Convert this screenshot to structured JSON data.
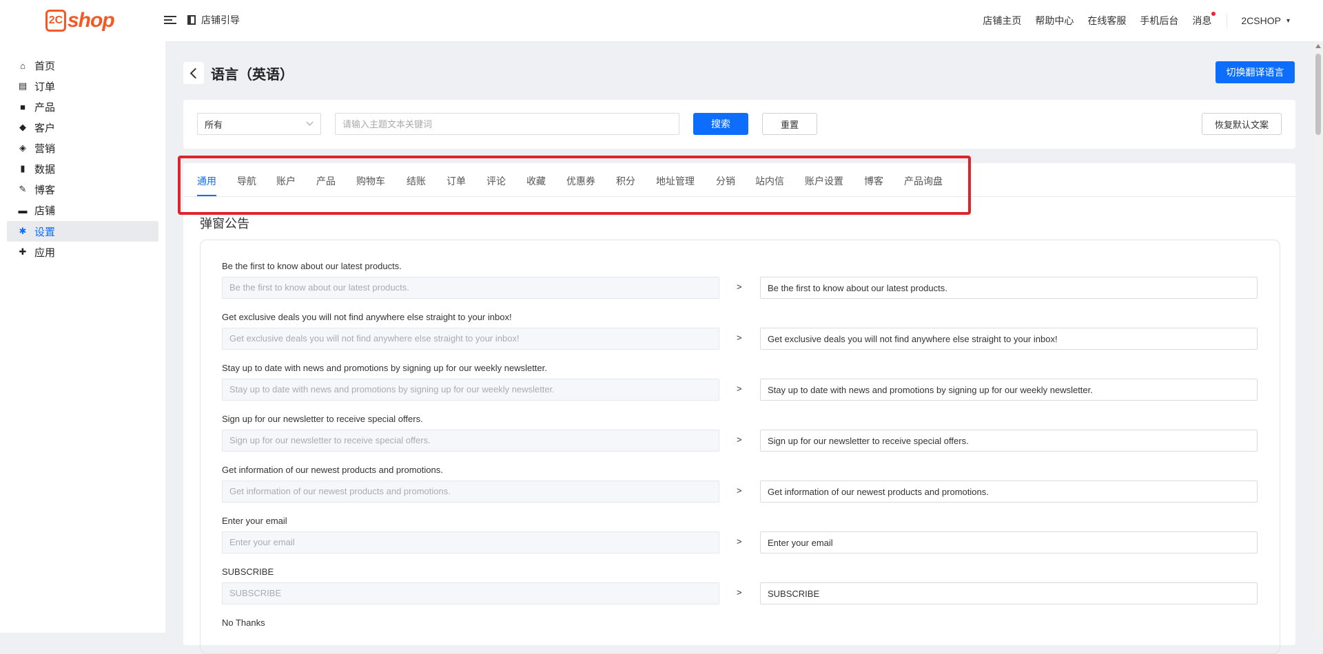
{
  "brand": {
    "logo_mark": "2C",
    "logo_text": "shop"
  },
  "header": {
    "guide_label": "店铺引导",
    "links": [
      "店铺主页",
      "帮助中心",
      "在线客服",
      "手机后台",
      "消息"
    ],
    "user": "2CSHOP"
  },
  "sidebar": {
    "items": [
      {
        "label": "首页",
        "icon": "home-icon"
      },
      {
        "label": "订单",
        "icon": "clipboard-icon"
      },
      {
        "label": "产品",
        "icon": "bag-icon"
      },
      {
        "label": "客户",
        "icon": "diamond-icon"
      },
      {
        "label": "营销",
        "icon": "tag-icon"
      },
      {
        "label": "数据",
        "icon": "bar-chart-icon"
      },
      {
        "label": "博客",
        "icon": "edit-icon"
      },
      {
        "label": "店铺",
        "icon": "store-icon"
      },
      {
        "label": "设置",
        "icon": "gear-icon"
      },
      {
        "label": "应用",
        "icon": "puzzle-icon"
      }
    ],
    "active_index": 8
  },
  "page": {
    "title": "语言（英语）",
    "switch_button": "切换翻译语言"
  },
  "filter": {
    "select_value": "所有",
    "search_placeholder": "请输入主题文本关键词",
    "search_button": "搜索",
    "reset_button": "重置",
    "restore_button": "恢复默认文案"
  },
  "tabs": [
    "通用",
    "导航",
    "账户",
    "产品",
    "购物车",
    "结账",
    "订单",
    "评论",
    "收藏",
    "优惠券",
    "积分",
    "地址管理",
    "分销",
    "站内信",
    "账户设置",
    "博客",
    "产品询盘"
  ],
  "active_tab": 0,
  "section_title": "弹窗公告",
  "fields": [
    {
      "label": "Be the first to know about our latest products.",
      "source": "Be the first to know about our latest products.",
      "value": "Be the first to know about our latest products."
    },
    {
      "label": "Get exclusive deals you will not find anywhere else straight to your inbox!",
      "source": "Get exclusive deals you will not find anywhere else straight to your inbox!",
      "value": "Get exclusive deals you will not find anywhere else straight to your inbox!"
    },
    {
      "label": "Stay up to date with news and promotions by signing up for our weekly newsletter.",
      "source": "Stay up to date with news and promotions by signing up for our weekly newsletter.",
      "value": "Stay up to date with news and promotions by signing up for our weekly newsletter."
    },
    {
      "label": "Sign up for our newsletter to receive special offers.",
      "source": "Sign up for our newsletter to receive special offers.",
      "value": "Sign up for our newsletter to receive special offers."
    },
    {
      "label": "Get information of our newest products and promotions.",
      "source": "Get information of our newest products and promotions.",
      "value": "Get information of our newest products and promotions."
    },
    {
      "label": "Enter your email",
      "source": "Enter your email",
      "value": "Enter your email"
    },
    {
      "label": "SUBSCRIBE",
      "source": "SUBSCRIBE",
      "value": "SUBSCRIBE"
    },
    {
      "label": "No Thanks",
      "source": "",
      "value": ""
    }
  ],
  "arrow": ">",
  "colors": {
    "accent": "#0d6efd",
    "brand": "#f15a24",
    "highlight": "#e0222a"
  }
}
